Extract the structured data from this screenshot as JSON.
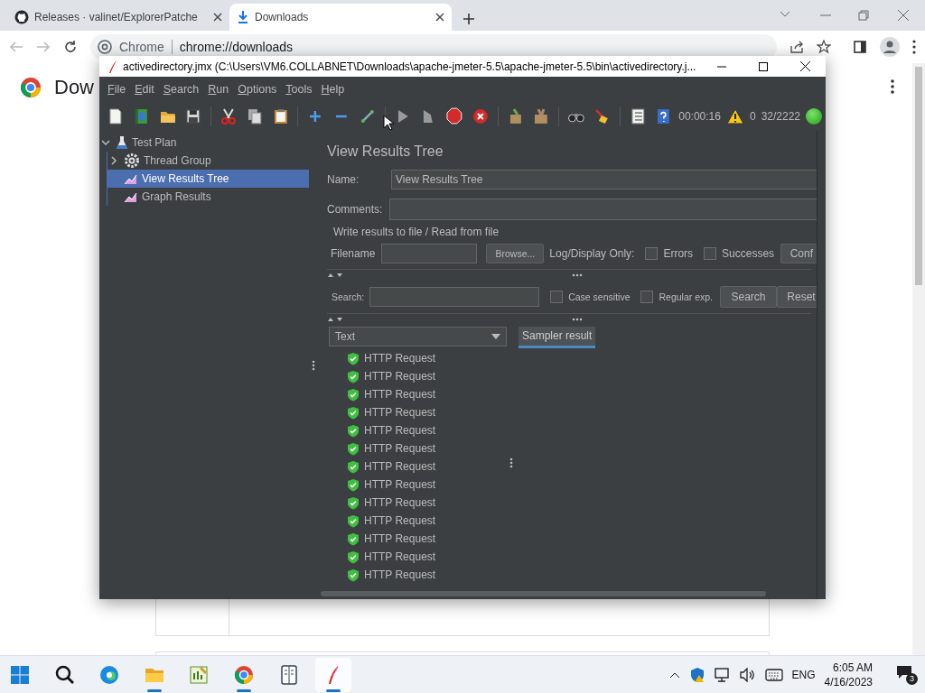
{
  "browser": {
    "tabs": [
      {
        "title": "Releases · valinet/ExplorerPatche",
        "kind": "github",
        "selected": false
      },
      {
        "title": "Downloads",
        "kind": "download",
        "selected": true
      }
    ],
    "address": {
      "chip": "Chrome",
      "url": "chrome://downloads"
    },
    "page": {
      "heading": "Dow"
    }
  },
  "jmeter": {
    "title": "activedirectory.jmx (C:\\Users\\VM6.COLLABNET\\Downloads\\apache-jmeter-5.5\\apache-jmeter-5.5\\bin\\activedirectory.j...",
    "menu": [
      "File",
      "Edit",
      "Search",
      "Run",
      "Options",
      "Tools",
      "Help"
    ],
    "toolbar": [
      {
        "kind": "new"
      },
      {
        "kind": "templates"
      },
      {
        "kind": "open"
      },
      {
        "kind": "save"
      },
      {
        "kind": "sep"
      },
      {
        "kind": "cut"
      },
      {
        "kind": "copy"
      },
      {
        "kind": "paste"
      },
      {
        "kind": "sep"
      },
      {
        "kind": "add"
      },
      {
        "kind": "remove"
      },
      {
        "kind": "toggle"
      },
      {
        "kind": "sep"
      },
      {
        "kind": "start"
      },
      {
        "kind": "start-no-pause"
      },
      {
        "kind": "stop"
      },
      {
        "kind": "shutdown"
      },
      {
        "kind": "sep"
      },
      {
        "kind": "clear"
      },
      {
        "kind": "clear-all"
      },
      {
        "kind": "sep"
      },
      {
        "kind": "search"
      },
      {
        "kind": "reset-search"
      },
      {
        "kind": "sep"
      },
      {
        "kind": "function"
      },
      {
        "kind": "help"
      }
    ],
    "status": {
      "elapsed": "00:00:16",
      "warnings": "0",
      "threads": "32/2222",
      "running": true
    },
    "tree": [
      {
        "label": "Test Plan",
        "kind": "test-plan",
        "expanded": true,
        "selected": false,
        "children": [
          {
            "label": "Thread Group",
            "kind": "thread-group",
            "expanded": false,
            "selected": false
          },
          {
            "label": "View Results Tree",
            "kind": "listener",
            "selected": true
          },
          {
            "label": "Graph Results",
            "kind": "listener",
            "selected": false
          }
        ]
      }
    ],
    "form": {
      "title": "View Results Tree",
      "name_label": "Name:",
      "name_value": "View Results Tree",
      "comments_label": "Comments:",
      "section": "Write results to file / Read from file",
      "filename_label": "Filename",
      "browse_button": "Browse...",
      "log_label": "Log/Display Only:",
      "errors": {
        "label": "Errors",
        "checked": false
      },
      "successes": {
        "label": "Successes",
        "checked": false
      },
      "configure_button": "Conf",
      "search_label": "Search:",
      "case_sensitive": {
        "label": "Case sensitive",
        "checked": false
      },
      "regular_exp": {
        "label": "Regular exp.",
        "checked": false
      },
      "search_button": "Search",
      "reset_button": "Reset"
    },
    "results": {
      "renderer": "Text",
      "tab": "Sampler result",
      "rows": [
        {
          "label": "HTTP Request",
          "success": true
        },
        {
          "label": "HTTP Request",
          "success": true
        },
        {
          "label": "HTTP Request",
          "success": true
        },
        {
          "label": "HTTP Request",
          "success": true
        },
        {
          "label": "HTTP Request",
          "success": true
        },
        {
          "label": "HTTP Request",
          "success": true
        },
        {
          "label": "HTTP Request",
          "success": true
        },
        {
          "label": "HTTP Request",
          "success": true
        },
        {
          "label": "HTTP Request",
          "success": true
        },
        {
          "label": "HTTP Request",
          "success": true
        },
        {
          "label": "HTTP Request",
          "success": true
        },
        {
          "label": "HTTP Request",
          "success": true
        },
        {
          "label": "HTTP Request",
          "success": true
        }
      ]
    }
  },
  "taskbar": {
    "apps": [
      {
        "kind": "start",
        "running": false,
        "selected": false
      },
      {
        "kind": "search",
        "running": false,
        "selected": false
      },
      {
        "kind": "edge",
        "running": false,
        "selected": false
      },
      {
        "kind": "explorer",
        "running": true,
        "selected": false
      },
      {
        "kind": "notepad",
        "running": false,
        "selected": false
      },
      {
        "kind": "chrome",
        "running": true,
        "selected": false
      },
      {
        "kind": "reader",
        "running": false,
        "selected": false
      },
      {
        "kind": "jmeter",
        "running": true,
        "selected": true
      }
    ],
    "language": "ENG",
    "time": "6:05 AM",
    "date": "4/16/2023",
    "notifications": "3"
  }
}
